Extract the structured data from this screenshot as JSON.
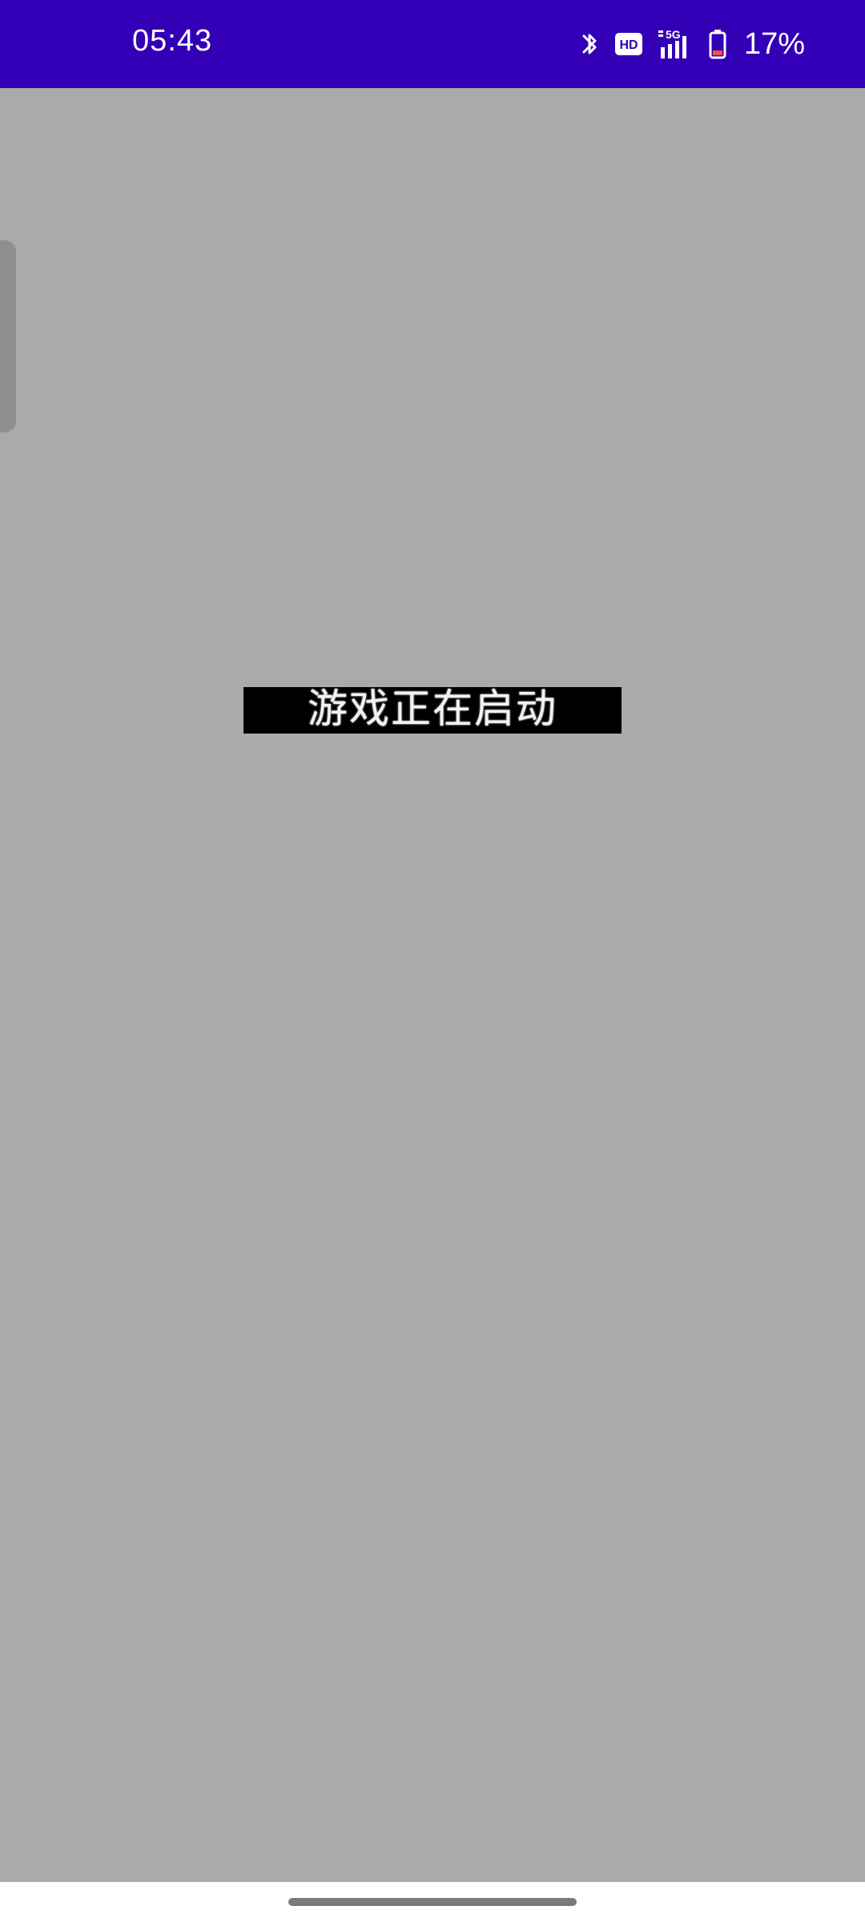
{
  "status_bar": {
    "time": "05:43",
    "hd_label": "HD",
    "network_label": "5G",
    "battery_percent": "17%",
    "colors": {
      "background": "#3300b7",
      "battery_low": "#ff4d4d"
    },
    "icons": [
      "bluetooth-icon",
      "hd-icon",
      "5g-signal-icon",
      "battery-icon"
    ]
  },
  "main": {
    "loading_text": "游戏正在启动",
    "background_color": "#aaaaaa"
  }
}
